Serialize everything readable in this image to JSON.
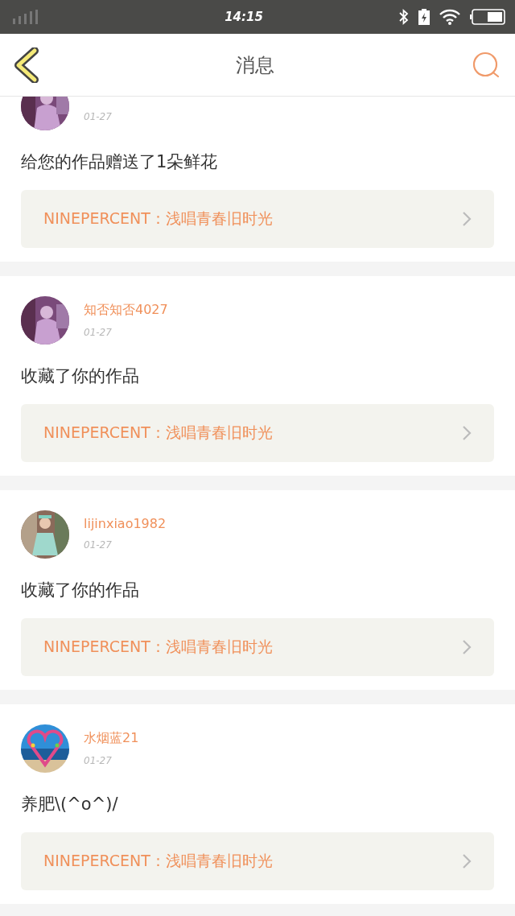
{
  "status_bar": {
    "time": "14:15"
  },
  "header": {
    "title": "消息"
  },
  "messages": [
    {
      "date": "01-27",
      "text": "给您的作品赠送了1朵鲜花",
      "work": "NINEPERCENT：浅唱青春旧时光"
    },
    {
      "name": "知否知否4027",
      "date": "01-27",
      "text": "收藏了你的作品",
      "work": "NINEPERCENT：浅唱青春旧时光"
    },
    {
      "name": "lijinxiao1982",
      "date": "01-27",
      "text": "收藏了你的作品",
      "work": "NINEPERCENT：浅唱青春旧时光"
    },
    {
      "name": "水烟蓝21",
      "date": "01-27",
      "text": "养肥\\(^o^)/",
      "work": "NINEPERCENT：浅唱青春旧时光"
    }
  ]
}
